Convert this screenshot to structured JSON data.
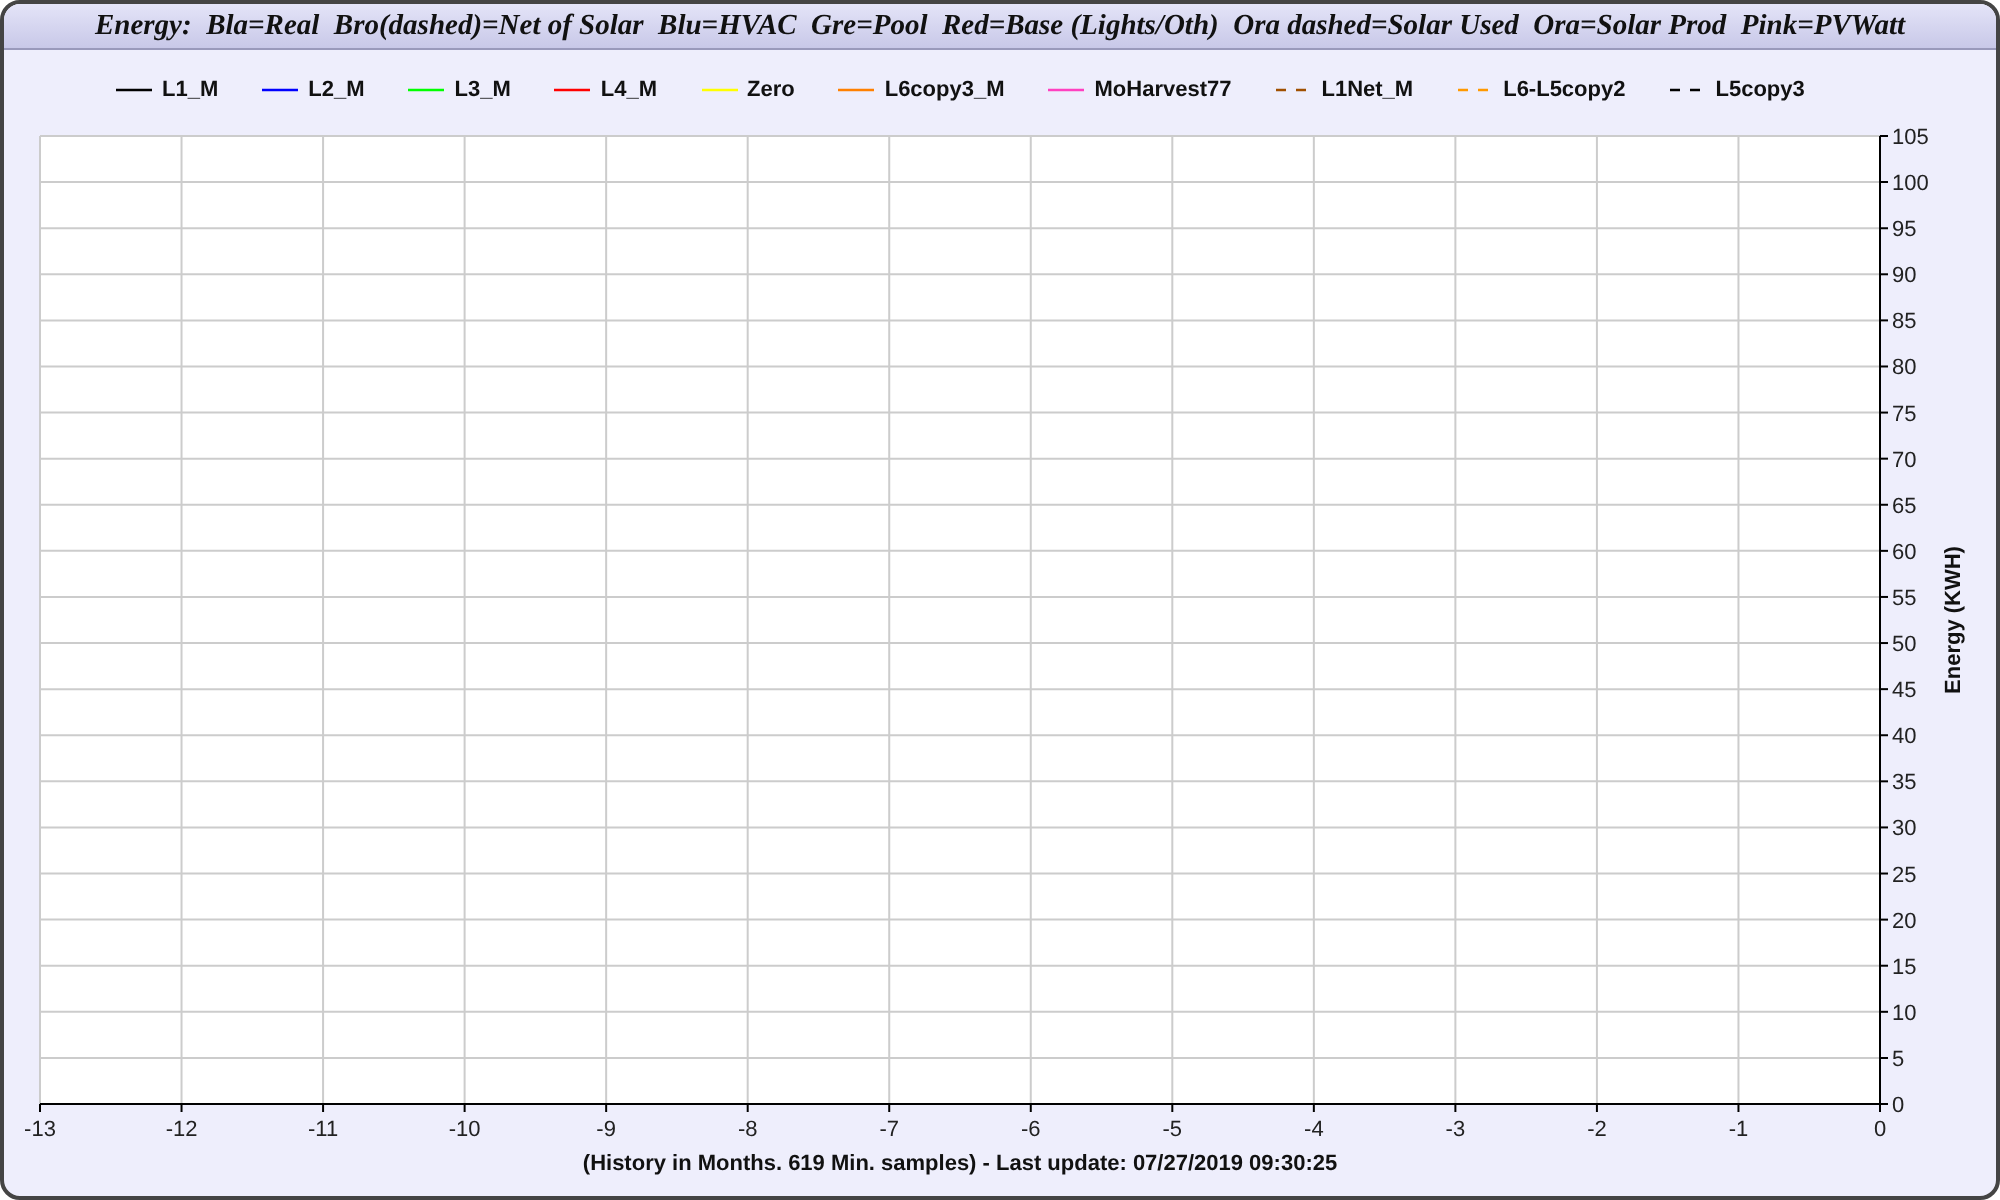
{
  "title": "Energy:  Bla=Real  Bro(dashed)=Net of Solar  Blu=HVAC  Gre=Pool  Red=Base (Lights/Oth)  Ora dashed=Solar Used  Ora=Solar Prod  Pink=PVWatt",
  "legend": [
    {
      "label": "L1_M",
      "color": "#000000",
      "kind": "solid"
    },
    {
      "label": "L2_M",
      "color": "#0000ff",
      "kind": "solid"
    },
    {
      "label": "L3_M",
      "color": "#00ff00",
      "kind": "solid"
    },
    {
      "label": "L4_M",
      "color": "#ff0000",
      "kind": "solid"
    },
    {
      "label": "Zero",
      "color": "#ffff00",
      "kind": "solid"
    },
    {
      "label": "L6copy3_M",
      "color": "#ff8000",
      "kind": "solid"
    },
    {
      "label": "MoHarvest77",
      "color": "#ff40c0",
      "kind": "solid"
    },
    {
      "label": "L1Net_M",
      "color": "#a05000",
      "kind": "dashed"
    },
    {
      "label": "L6-L5copy2",
      "color": "#ff9900",
      "kind": "dashed"
    },
    {
      "label": "L5copy3",
      "color": "#000000",
      "kind": "dashed"
    }
  ],
  "chart_data": {
    "type": "line",
    "xlabel": "(History in Months. 619 Min. samples) - Last update: 07/27/2019 09:30:25",
    "ylabel": "Energy (KWH)",
    "grid": true,
    "xlim": [
      -13,
      0
    ],
    "ylim": [
      0,
      105
    ],
    "xticks": [
      -13,
      -12,
      -11,
      -10,
      -9,
      -8,
      -7,
      -6,
      -5,
      -4,
      -3,
      -2,
      -1,
      0
    ],
    "yticks": [
      0,
      5,
      10,
      15,
      20,
      25,
      30,
      35,
      40,
      45,
      50,
      55,
      60,
      65,
      70,
      75,
      80,
      85,
      90,
      95,
      100,
      105
    ]
  }
}
